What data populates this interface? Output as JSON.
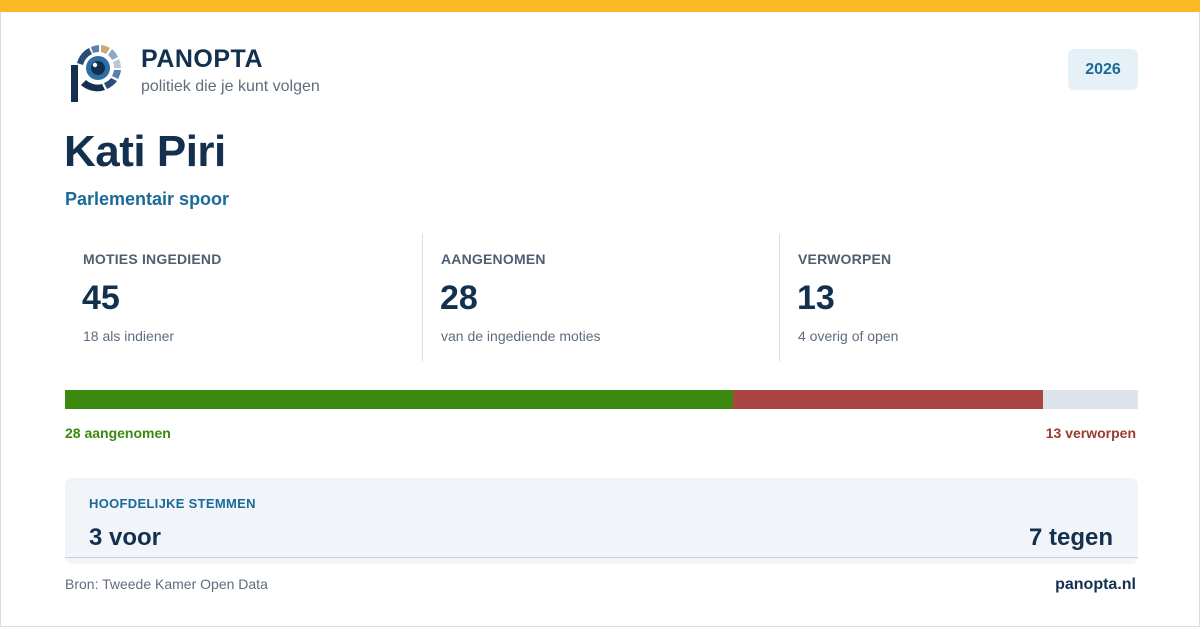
{
  "colors": {
    "accent_bar": "#fbb924",
    "brand_navy": "#13304f",
    "brand_blue": "#1a6a99",
    "accepted": "#3b8a0f",
    "rejected": "#ab4444",
    "remaining": "#dde3ea"
  },
  "brand": {
    "logo_icon": "panopta-eye-logo-icon",
    "name": "PANOPTA",
    "tagline": "politiek die je kunt volgen"
  },
  "year": "2026",
  "person": {
    "name": "Kati Piri",
    "track": "Parlementair spoor"
  },
  "stats": [
    {
      "label": "MOTIES INGEDIEND",
      "value": "45",
      "sub": "18 als indiener"
    },
    {
      "label": "AANGENOMEN",
      "value": "28",
      "sub": "van de ingediende moties"
    },
    {
      "label": "VERWORPEN",
      "value": "13",
      "sub": "4 overig of open"
    }
  ],
  "progress": {
    "total": 45,
    "accepted": 28,
    "rejected": 13,
    "accepted_label": "28 aangenomen",
    "rejected_label": "13 verworpen"
  },
  "votes": {
    "heading": "HOOFDELIJKE STEMMEN",
    "for": "3 voor",
    "against": "7 tegen"
  },
  "footer": {
    "source": "Bron: Tweede Kamer Open Data",
    "site": "panopta.nl"
  }
}
